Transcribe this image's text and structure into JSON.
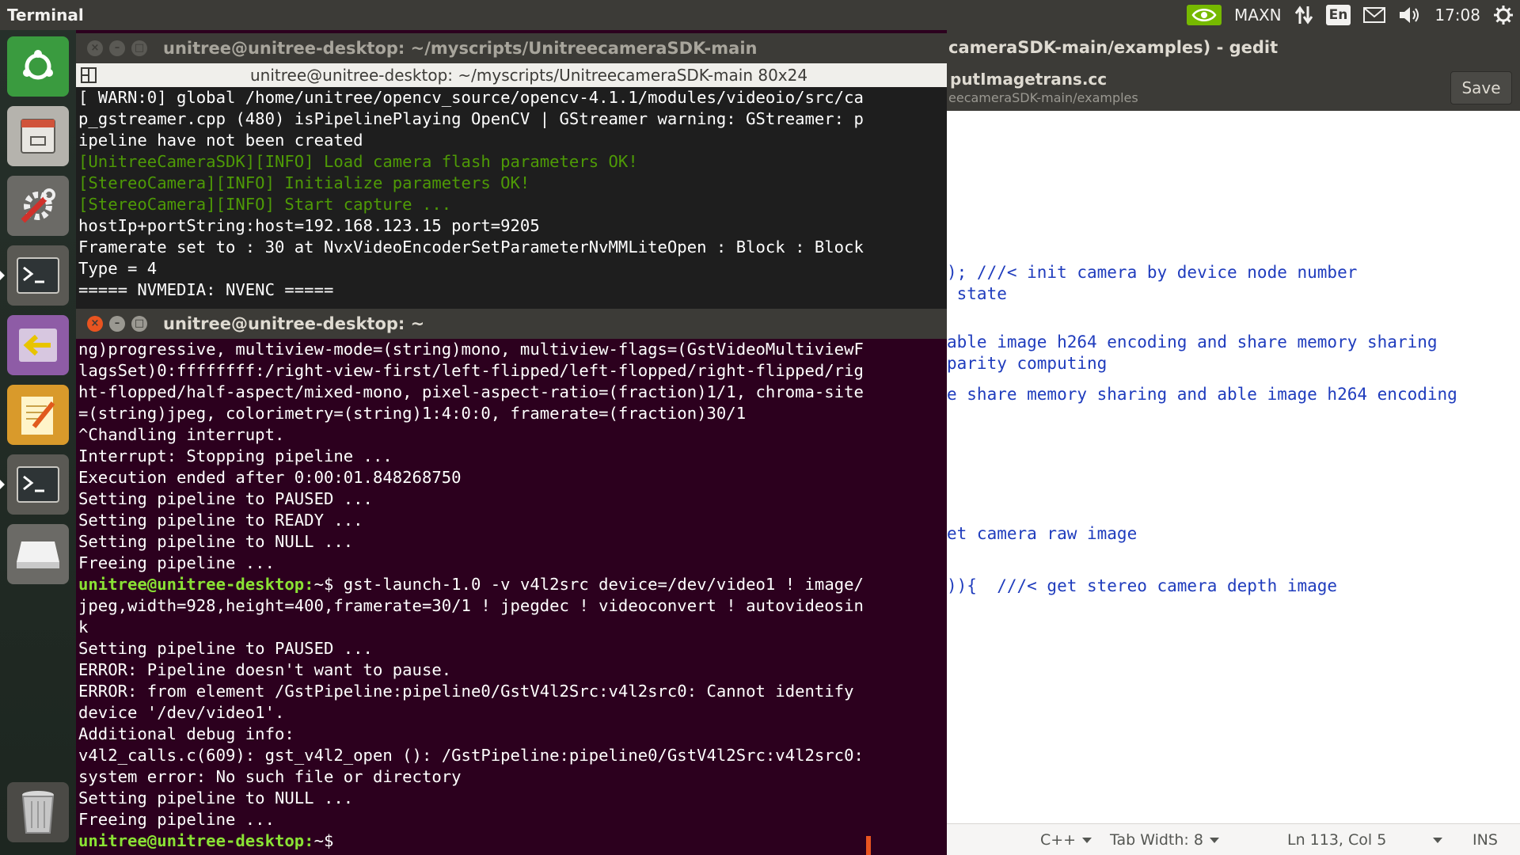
{
  "top_panel": {
    "app_title": "Terminal",
    "power_mode": "MAXN",
    "keyboard_layout": "En",
    "clock": "17:08",
    "icons": [
      "nvidia-icon",
      "network-icon",
      "keyboard-icon",
      "mail-icon",
      "volume-icon",
      "gear-icon"
    ]
  },
  "launcher": {
    "items": [
      "ubuntu-logo-icon",
      "files-icon",
      "system-settings-icon",
      "terminal-icon",
      "exit-icon",
      "text-editor-icon",
      "terminal-icon",
      "drive-icon",
      "trash-icon"
    ]
  },
  "gedit": {
    "title": "cameraSDK-main/examples) - gedit",
    "filename": "putImagetrans.cc",
    "filepath": "eecameraSDK-main/examples",
    "save_label": "Save",
    "code_lines": [
      "); ///< init camera by device node number",
      " state",
      "able image h264 encoding and share memory sharing",
      "parity computing",
      "e share memory sharing and able image h264 encoding",
      "et camera raw image",
      ")){  ///< get stereo camera depth image"
    ],
    "status": {
      "language": "C++",
      "tab_width": "Tab Width: 8",
      "position": "Ln 113, Col 5",
      "mode": "INS"
    }
  },
  "terminal1": {
    "title": "unitree@unitree-desktop: ~/myscripts/UnitreecameraSDK-main",
    "tab_title": "unitree@unitree-desktop: ~/myscripts/UnitreecameraSDK-main 80x24",
    "lines": [
      {
        "text": "[ WARN:0] global /home/unitree/opencv_source/opencv-4.1.1/modules/videoio/src/ca",
        "style": "plain"
      },
      {
        "text": "p_gstreamer.cpp (480) isPipelinePlaying OpenCV | GStreamer warning: GStreamer: p",
        "style": "plain"
      },
      {
        "text": "ipeline have not been created",
        "style": "plain"
      },
      {
        "text": "[UnitreeCameraSDK][INFO] Load camera flash parameters OK!",
        "style": "green"
      },
      {
        "text": "[StereoCamera][INFO] Initialize parameters OK!",
        "style": "green"
      },
      {
        "text": "[StereoCamera][INFO] Start capture ...",
        "style": "green"
      },
      {
        "text": "hostIp+portString:host=192.168.123.15 port=9205",
        "style": "plain"
      },
      {
        "text": "Framerate set to : 30 at NvxVideoEncoderSetParameterNvMMLiteOpen : Block : Block",
        "style": "plain"
      },
      {
        "text": "Type = 4",
        "style": "plain"
      },
      {
        "text": "===== NVMEDIA: NVENC =====",
        "style": "plain"
      }
    ]
  },
  "terminal2": {
    "title": "unitree@unitree-desktop: ~",
    "prompt": "unitree@unitree-desktop:",
    "prompt_path": "~$",
    "lines": [
      {
        "text": "ng)progressive, multiview-mode=(string)mono, multiview-flags=(GstVideoMultiviewF"
      },
      {
        "text": "lagsSet)0:ffffffff:/right-view-first/left-flipped/left-flopped/right-flipped/rig"
      },
      {
        "text": "ht-flopped/half-aspect/mixed-mono, pixel-aspect-ratio=(fraction)1/1, chroma-site"
      },
      {
        "text": "=(string)jpeg, colorimetry=(string)1:4:0:0, framerate=(fraction)30/1"
      },
      {
        "text": "^Chandling interrupt."
      },
      {
        "text": "Interrupt: Stopping pipeline ..."
      },
      {
        "text": "Execution ended after 0:00:01.848268750"
      },
      {
        "text": "Setting pipeline to PAUSED ..."
      },
      {
        "text": "Setting pipeline to READY ..."
      },
      {
        "text": "Setting pipeline to NULL ..."
      },
      {
        "text": "Freeing pipeline ..."
      },
      {
        "text": " gst-launch-1.0 -v v4l2src device=/dev/video1 ! image/",
        "prompt": true
      },
      {
        "text": "jpeg,width=928,height=400,framerate=30/1 ! jpegdec ! videoconvert ! autovideosin"
      },
      {
        "text": "k"
      },
      {
        "text": "Setting pipeline to PAUSED ..."
      },
      {
        "text": "ERROR: Pipeline doesn't want to pause."
      },
      {
        "text": "ERROR: from element /GstPipeline:pipeline0/GstV4l2Src:v4l2src0: Cannot identify"
      },
      {
        "text": "device '/dev/video1'."
      },
      {
        "text": "Additional debug info:"
      },
      {
        "text": "v4l2_calls.c(609): gst_v4l2_open (): /GstPipeline:pipeline0/GstV4l2Src:v4l2src0:"
      },
      {
        "text": "system error: No such file or directory"
      },
      {
        "text": "Setting pipeline to NULL ..."
      },
      {
        "text": "Freeing pipeline ..."
      },
      {
        "text": "",
        "prompt": true
      }
    ]
  },
  "colors": {
    "panel": "#3c3b37",
    "terminal_bg": "#2c001e",
    "prompt_green": "#8ae234",
    "info_green": "#4e9a06",
    "close_red": "#e95420",
    "code_blue": "#1f3cbd"
  }
}
